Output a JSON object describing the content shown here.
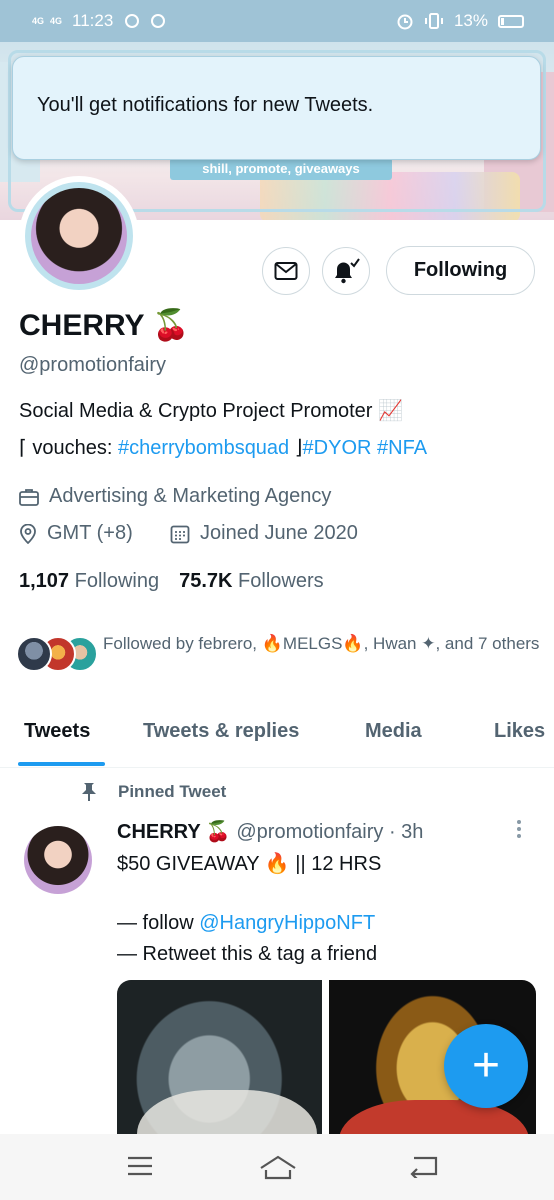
{
  "status_bar": {
    "network1": "4G",
    "network2": "4G",
    "time": "11:23",
    "battery": "13%"
  },
  "banner": {
    "tag": "shill, promote, giveaways"
  },
  "toast": {
    "message": "You'll get notifications for new Tweets."
  },
  "profile": {
    "name": "CHERRY 🍒",
    "handle": "@promotionfairy",
    "bio_line1": "Social Media & Crypto Project Promoter 📈",
    "bio_line2_prefix": "⌈ vouches: ",
    "bio_line2_tag1": "#cherrybombsquad",
    "bio_line2_mid": " ⌋",
    "bio_line2_tag2": "#DYOR",
    "bio_line2_tag3": "#NFA",
    "category": "Advertising & Marketing Agency",
    "location": "GMT (+8)",
    "joined": "Joined June 2020",
    "following_count": "1,107",
    "following_label": "Following",
    "followers_count": "75.7K",
    "followers_label": "Followers",
    "followed_by": "Followed by febrero, 🔥MELGS🔥, Hwan ✦, and 7 others",
    "follow_button": "Following"
  },
  "tabs": [
    {
      "label": "Tweets",
      "active": true
    },
    {
      "label": "Tweets & replies",
      "active": false
    },
    {
      "label": "Media",
      "active": false
    },
    {
      "label": "Likes",
      "active": false
    }
  ],
  "pinned_tweet": {
    "pinned_label": "Pinned Tweet",
    "author_name": "CHERRY 🍒",
    "author_handle": "@promotionfairy",
    "time": "· 3h",
    "line1": "$50 GIVEAWAY 🔥 || 12 HRS",
    "line2_prefix": "— follow ",
    "line2_mention": "@HangryHippoNFT",
    "line3": "— Retweet this & tag a friend"
  },
  "fab_label": "+",
  "colors": {
    "accent": "#1d9bf0",
    "secondary_text": "#536471",
    "primary_text": "#0f1419"
  },
  "icons": [
    "mail-icon",
    "bell-icon",
    "briefcase-icon",
    "location-icon",
    "calendar-icon",
    "pin-icon",
    "more-vertical-icon",
    "menu-icon",
    "home-icon",
    "back-icon"
  ]
}
